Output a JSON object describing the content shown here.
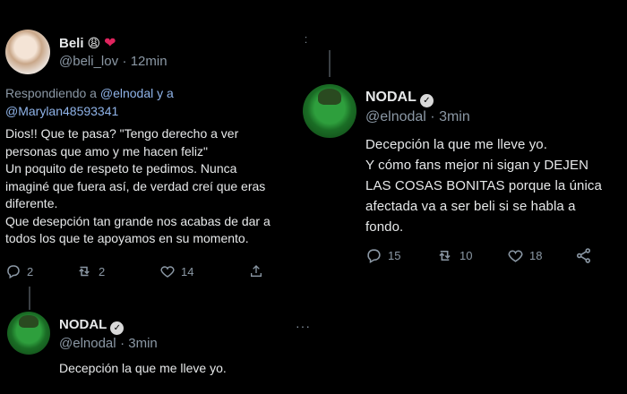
{
  "left": {
    "beli": {
      "name": "Beli",
      "handle": "@beli_lov",
      "time": "· 12min",
      "emoji1": "😩",
      "emoji2": "❤",
      "replying_prefix": "Respondiendo a ",
      "replying_link1": "@elnodal y a",
      "replying_link2": "@Marylan48593341",
      "text": "Dios!! Que te pasa? \"Tengo derecho a ver\npersonas que amo y me hacen feliz\"\nUn poquito de respeto te pedimos. Nunca\nimaginé que fuera así, de verdad creí que eras\ndiferente.\nQue desepción tan grande nos acabas de dar a\ntodos los que te apoyamos en su momento.",
      "actions": {
        "replies": "2",
        "retweets": "2",
        "likes": "14"
      }
    },
    "nodal": {
      "name": "NODAL",
      "handle": "@elnodal",
      "time": "· 3min",
      "text": "Decepción la que me lleve yo."
    }
  },
  "right": {
    "nodal": {
      "name": "NODAL",
      "handle": "@elnodal",
      "time": "· 3min",
      "text": "Decepción la que me lleve yo.\n Y cómo fans mejor ni sigan y DEJEN\nLAS COSAS BONITAS porque la única\nafectada va a ser beli si se habla a\nfondo.",
      "actions": {
        "replies": "15",
        "retweets": "10",
        "likes": "18"
      }
    }
  },
  "icons": {
    "reply": "reply-icon",
    "retweet": "retweet-icon",
    "like": "heart-icon",
    "share": "share-icon",
    "more": "more-icon",
    "verified": "verified-icon"
  },
  "colors": {
    "background": "#000000",
    "text": "#e7e9ea",
    "muted": "#8b98a5",
    "link": "#8fb3e8"
  }
}
